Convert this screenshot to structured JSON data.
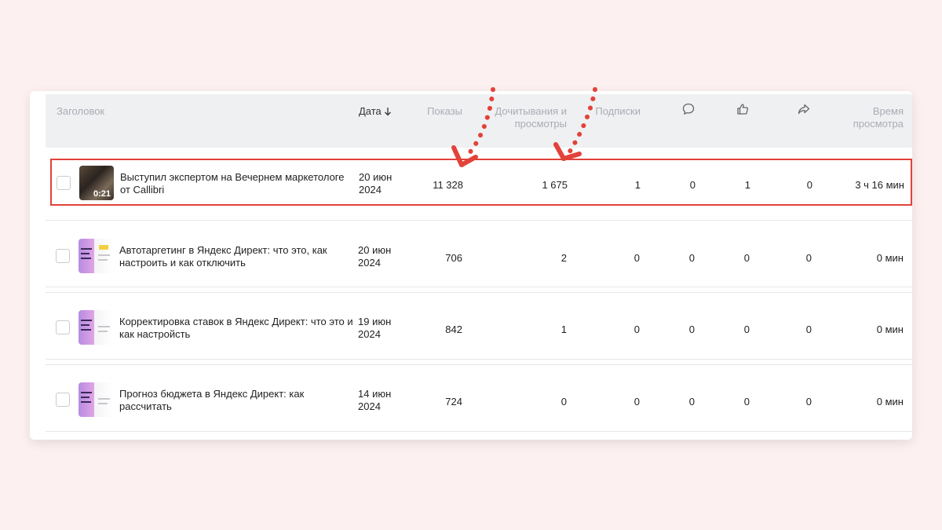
{
  "columns": {
    "title": "Заголовок",
    "date": "Дата",
    "impressions": "Показы",
    "reads": "Дочитывания и просмотры",
    "subscriptions": "Подписки",
    "comments_icon": "comment-icon",
    "likes_icon": "thumbs-up-icon",
    "shares_icon": "share-icon",
    "watch_time": "Время просмотра"
  },
  "rows": [
    {
      "thumb_type": "video",
      "duration": "0:21",
      "title": "Выступил экспертом на Вечернем маркетологе от Callibri",
      "date": "20 июн 2024",
      "impressions": "11 328",
      "reads": "1 675",
      "subscriptions": "1",
      "comments": "0",
      "likes": "1",
      "shares": "0",
      "watch_time": "3 ч 16 мин"
    },
    {
      "thumb_type": "article",
      "title": "Автотаргетинг в Яндекс Директ: что это, как настроить и как отключить",
      "date": "20 июн 2024",
      "impressions": "706",
      "reads": "2",
      "subscriptions": "0",
      "comments": "0",
      "likes": "0",
      "shares": "0",
      "watch_time": "0 мин"
    },
    {
      "thumb_type": "article",
      "title": "Корректировка ставок в Яндекс Директ: что это и как настройсть",
      "date": "19 июн 2024",
      "impressions": "842",
      "reads": "1",
      "subscriptions": "0",
      "comments": "0",
      "likes": "0",
      "shares": "0",
      "watch_time": "0 мин"
    },
    {
      "thumb_type": "article",
      "title": "Прогноз бюджета в Яндекс Директ: как рассчитать",
      "date": "14 июн 2024",
      "impressions": "724",
      "reads": "0",
      "subscriptions": "0",
      "comments": "0",
      "likes": "0",
      "shares": "0",
      "watch_time": "0 мин"
    }
  ],
  "colors": {
    "highlight": "#e2423a",
    "background": "#fdf0f0",
    "header_bg": "#eff0f2"
  }
}
